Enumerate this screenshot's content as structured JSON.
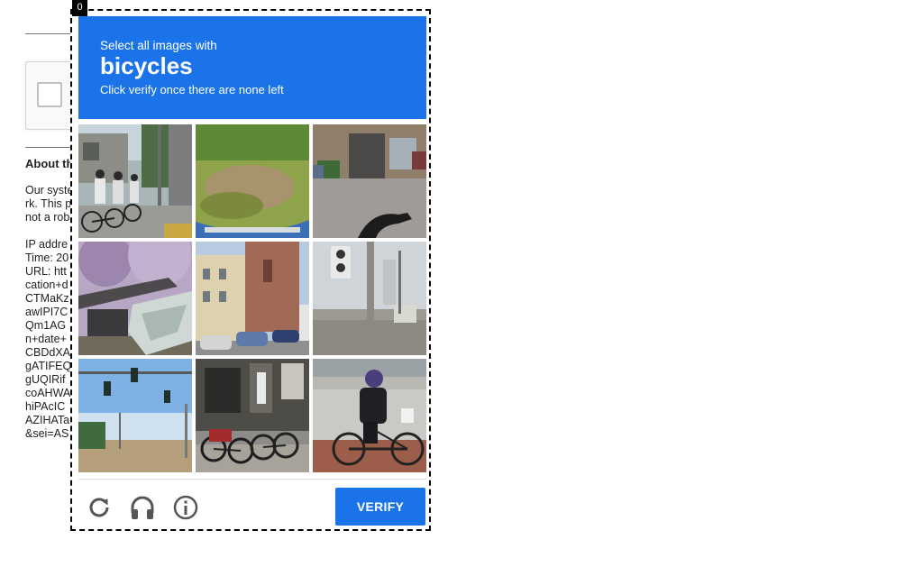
{
  "frame_index": "0",
  "background_page": {
    "heading": "About th",
    "paragraph_lines": "Our syste\nrk. This p\nnot a rob",
    "details_lines": "IP addre\nTime: 20\nURL: htt\ncation+d\nCTMaKz\nawIPI7C\nQm1AG\nn+date+\nCBDdXA\ngATIFEQ\ngUQIRif\ncoAHWA\nhiPAcIC\nAZIHATa\n&sei=AS"
  },
  "challenge": {
    "instruction_prefix": "Select all images with",
    "target_object": "bicycles",
    "instruction_suffix": "Click verify once there are none left",
    "tiles": [
      {
        "label": "Students with bicycles on sidewalk",
        "scene": "street-students"
      },
      {
        "label": "Grass patch with blue handlebar",
        "scene": "grass"
      },
      {
        "label": "Building entrance with bicycle handle",
        "scene": "building-bike"
      },
      {
        "label": "Blossom tree and broken roof",
        "scene": "blossom"
      },
      {
        "label": "Church tower and parked cars",
        "scene": "church"
      },
      {
        "label": "Traffic light at intersection",
        "scene": "traffic-light"
      },
      {
        "label": "Traffic lights under blue sky",
        "scene": "traffic-sky"
      },
      {
        "label": "Bicycles parked by storefront",
        "scene": "parked-bikes"
      },
      {
        "label": "Man riding bicycle",
        "scene": "cyclist"
      }
    ],
    "verify_label": "VERIFY",
    "reload_icon": "reload-icon",
    "audio_icon": "headphones-icon",
    "info_icon": "info-icon"
  },
  "colors": {
    "accent": "#1a73e8",
    "icon_gray": "#555555"
  }
}
